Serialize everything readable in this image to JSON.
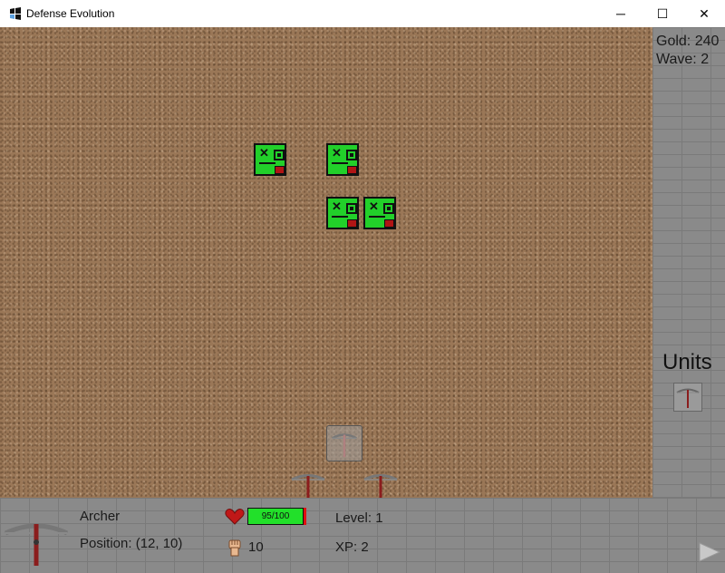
{
  "window": {
    "title": "Defense Evolution",
    "controls": {
      "minimize": "─",
      "maximize": "☐",
      "close": "✕"
    }
  },
  "hud": {
    "gold": "Gold: 240",
    "wave": "Wave: 2"
  },
  "units_panel": {
    "title": "Units",
    "units": [
      {
        "icon": "crossbow-icon"
      }
    ]
  },
  "selected_unit": {
    "name": "Archer",
    "position": "Position: (12, 10)",
    "health_text": "95/100",
    "health_fraction": 0.95,
    "damage": "10",
    "level": "Level: 1",
    "xp": "XP: 2",
    "icons": [
      "heart-icon",
      "fist-icon",
      "crossbow-icon"
    ]
  },
  "board": {
    "enemies": [
      {
        "type": "green-creature"
      },
      {
        "type": "green-creature"
      },
      {
        "type": "green-creature"
      },
      {
        "type": "green-creature"
      }
    ],
    "towers": [
      {
        "type": "crossbow",
        "selected": true
      },
      {
        "type": "crossbow"
      },
      {
        "type": "crossbow"
      }
    ]
  },
  "controls": {
    "next_wave_icon": "play-icon"
  },
  "colors": {
    "enemy": "#22d02a",
    "health": "#22e02a",
    "dirt": "#9a7757",
    "brick": "#8a8a8a"
  }
}
